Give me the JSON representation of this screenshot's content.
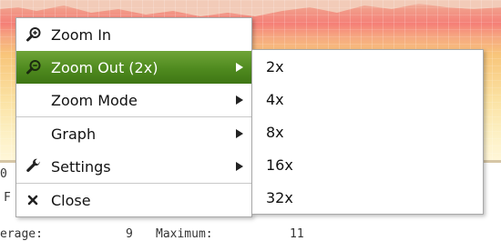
{
  "background": {
    "partial_text_left": "F",
    "footer_stats": {
      "average_label": "erage:",
      "average_value": "9",
      "maximum_label": "Maximum:",
      "maximum_value": "11"
    }
  },
  "menu": {
    "items": [
      {
        "label": "Zoom In",
        "icon": "zoom-in-icon"
      },
      {
        "label": "Zoom Out (2x)",
        "icon": "zoom-out-icon",
        "active": true
      },
      {
        "label": "Zoom Mode"
      },
      {
        "label": "Graph"
      },
      {
        "label": "Settings",
        "icon": "wrench-icon"
      },
      {
        "label": "Close",
        "icon": "close-icon"
      }
    ]
  },
  "submenu": {
    "items": [
      {
        "label": "2x"
      },
      {
        "label": "4x"
      },
      {
        "label": "8x"
      },
      {
        "label": "16x"
      },
      {
        "label": "32x"
      }
    ]
  },
  "colors": {
    "active_item": "#4f8a1f",
    "graph_peak": "#f57f77",
    "graph_fill": "#fbe2a3"
  }
}
